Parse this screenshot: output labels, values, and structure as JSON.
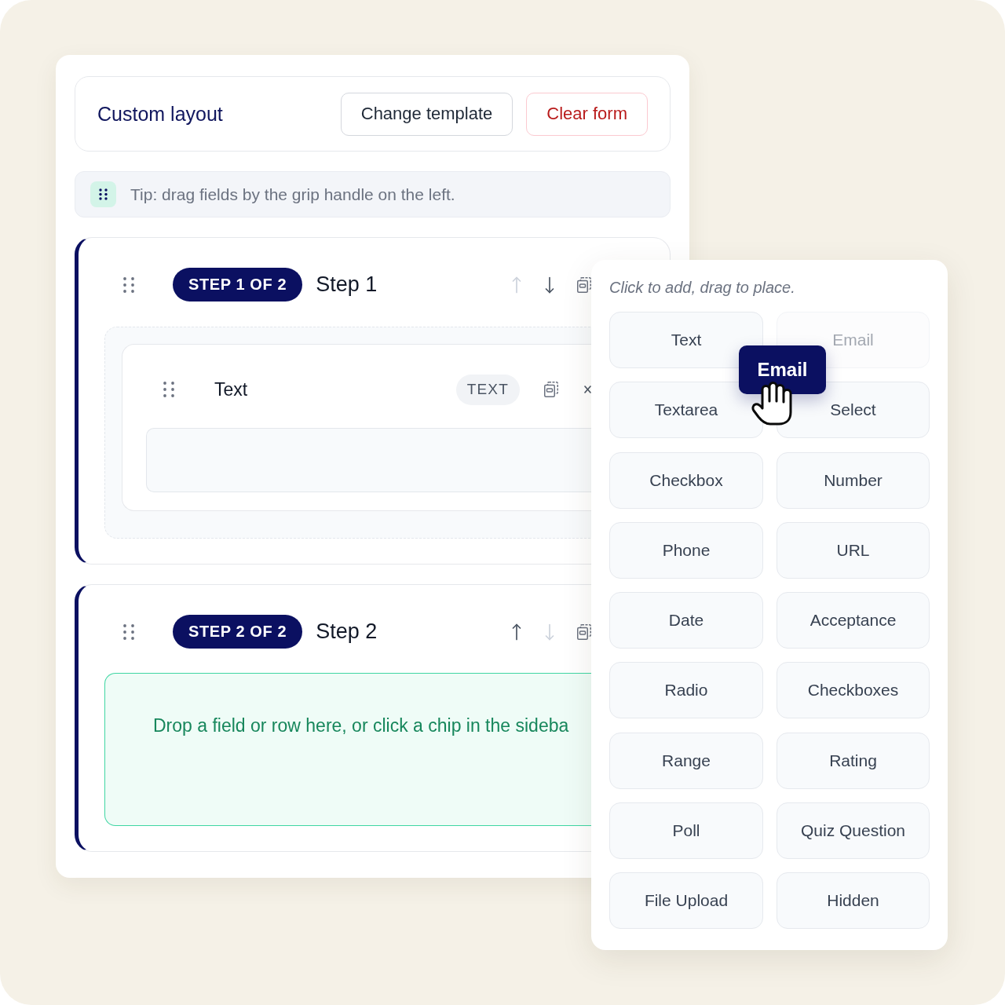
{
  "header": {
    "title": "Custom layout",
    "buttons": [
      {
        "label": "Change template",
        "kind": "outline"
      },
      {
        "label": "Clear form",
        "kind": "danger"
      }
    ]
  },
  "tip": {
    "text": "Tip: drag fields by the grip handle on the left."
  },
  "steps": [
    {
      "badge": "STEP 1 OF 2",
      "title": "Step 1",
      "up_disabled": true,
      "down_disabled": false,
      "content": {
        "kind": "fields",
        "fields": [
          {
            "label": "Text",
            "type": "TEXT"
          }
        ]
      }
    },
    {
      "badge": "STEP 2 OF 2",
      "title": "Step 2",
      "up_disabled": false,
      "down_disabled": true,
      "content": {
        "kind": "dropzone",
        "hint": "Drop a field or row here, or click a chip in the sideba"
      }
    }
  ],
  "palette": {
    "hint": "Click to add, drag to place.",
    "chips": [
      {
        "label": "Text",
        "dragging": false
      },
      {
        "label": "Email",
        "dragging": true
      },
      {
        "label": "Textarea",
        "dragging": false
      },
      {
        "label": "Select",
        "dragging": false
      },
      {
        "label": "Checkbox",
        "dragging": false
      },
      {
        "label": "Number",
        "dragging": false
      },
      {
        "label": "Phone",
        "dragging": false
      },
      {
        "label": "URL",
        "dragging": false
      },
      {
        "label": "Date",
        "dragging": false
      },
      {
        "label": "Acceptance",
        "dragging": false
      },
      {
        "label": "Radio",
        "dragging": false
      },
      {
        "label": "Checkboxes",
        "dragging": false
      },
      {
        "label": "Range",
        "dragging": false
      },
      {
        "label": "Rating",
        "dragging": false
      },
      {
        "label": "Poll",
        "dragging": false
      },
      {
        "label": "Quiz Question",
        "dragging": false
      },
      {
        "label": "File Upload",
        "dragging": false
      },
      {
        "label": "Hidden",
        "dragging": false
      }
    ],
    "drag_preview": {
      "label": "Email"
    }
  }
}
